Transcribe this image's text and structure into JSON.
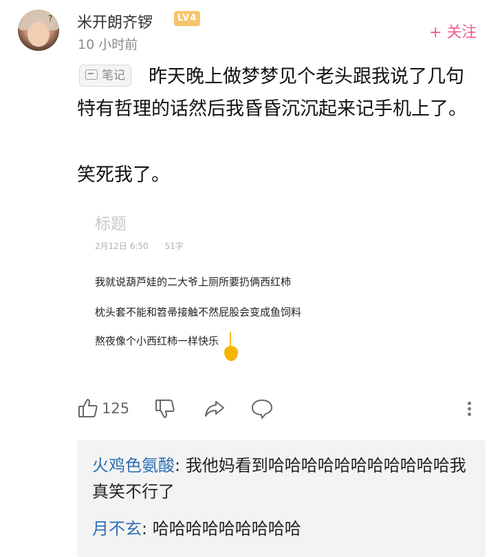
{
  "post": {
    "username": "米开朗齐锣",
    "level": "LV4",
    "time": "10 小时前",
    "follow": "+ 关注",
    "tag": "笔记",
    "text_p1": "昨天晚上做梦梦见个老头跟我说了几句特有哲理的话然后我昏昏沉沉起来记手机上了。",
    "text_p2": "笑死我了。"
  },
  "screenshot": {
    "title": "标题",
    "date": "2月12日 6:50",
    "count": "51字",
    "lines": [
      "我就说葫芦娃的二大爷上厕所要扔俩西红柿",
      "枕头套不能和笤帚接触不然屁股会变成鱼饲料",
      "熬夜像个小西红柿一样快乐"
    ]
  },
  "actions": {
    "like_count": "125",
    "icons": [
      "thumbs-up-icon",
      "thumbs-down-icon",
      "share-icon",
      "comment-icon",
      "more-icon"
    ]
  },
  "comments": [
    {
      "author": "火鸡色氨酸",
      "text": ": 我他妈看到哈哈哈哈哈哈哈哈哈哈哈我真笑不行了"
    },
    {
      "author": "月不玄",
      "text": ": 哈哈哈哈哈哈哈哈哈"
    }
  ],
  "colors": {
    "accent_pink": "#ee5d87",
    "author_blue": "#2f6fb5",
    "level_badge": "#f6c56a",
    "cursor_yellow": "#f5b400"
  }
}
